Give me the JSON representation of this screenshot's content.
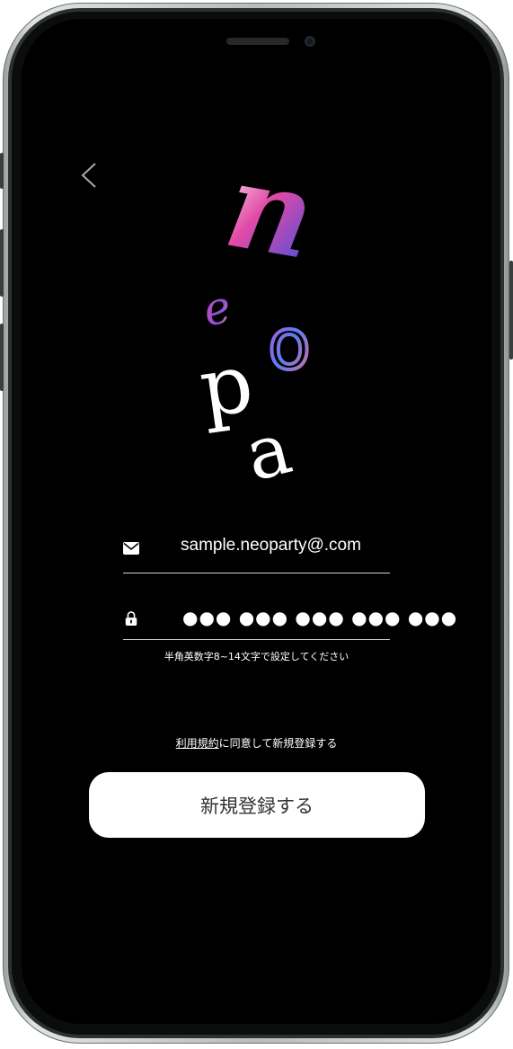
{
  "app": {
    "logo_letters": [
      "n",
      "e",
      "o",
      "p",
      "a"
    ],
    "accent_colors": [
      "#e14aa6",
      "#6b4fd8",
      "#3a6ee8",
      "#f4b36b"
    ]
  },
  "nav": {
    "back_icon": "chevron-left-icon"
  },
  "form": {
    "email": {
      "icon": "mail-icon",
      "value": "sample.neoparty@.com"
    },
    "password": {
      "icon": "lock-icon",
      "value": "●●● ●●● ●●● ●●● ●●●"
    },
    "password_hint": "半角英数字8~14文字で設定してください"
  },
  "terms": {
    "link_text": "利用規約",
    "rest_text": "に同意して新規登録する"
  },
  "submit": {
    "label": "新規登録する"
  }
}
